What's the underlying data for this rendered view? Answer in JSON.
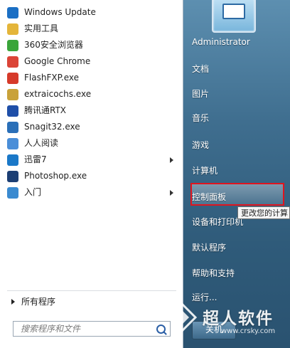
{
  "left_panel": {
    "items": [
      {
        "label": "Windows Update",
        "icon": "windows-update-icon",
        "color": "#1b6fc4",
        "submenu": false
      },
      {
        "label": "实用工具",
        "icon": "folder-icon",
        "color": "#e4b53a",
        "submenu": false
      },
      {
        "label": "360安全浏览器",
        "icon": "browser-360-icon",
        "color": "#3aa53a",
        "submenu": false
      },
      {
        "label": "Google Chrome",
        "icon": "chrome-icon",
        "color": "#db4437",
        "submenu": false
      },
      {
        "label": "FlashFXP.exe",
        "icon": "flashfxp-icon",
        "color": "#d63a2a",
        "submenu": false
      },
      {
        "label": "extraicochs.exe",
        "icon": "extraico-icon",
        "color": "#c9a23a",
        "submenu": false
      },
      {
        "label": "腾讯通RTX",
        "icon": "rtx-icon",
        "color": "#1f4fa8",
        "submenu": false
      },
      {
        "label": "Snagit32.exe",
        "icon": "snagit-icon",
        "color": "#2a6fb8",
        "submenu": false
      },
      {
        "label": "人人阅读",
        "icon": "reader-icon",
        "color": "#4a8ed8",
        "submenu": false
      },
      {
        "label": "迅雷7",
        "icon": "thunder-icon",
        "color": "#1a78c8",
        "submenu": true
      },
      {
        "label": "Photoshop.exe",
        "icon": "photoshop-icon",
        "color": "#1c3f74",
        "submenu": false
      },
      {
        "label": "入门",
        "icon": "getting-started-icon",
        "color": "#3a8ad0",
        "submenu": true
      }
    ],
    "all_programs": "所有程序",
    "search_placeholder": "搜索程序和文件"
  },
  "right_panel": {
    "items": [
      "Administrator",
      "文档",
      "图片",
      "音乐",
      "游戏",
      "计算机",
      "控制面板",
      "设备和打印机",
      "默认程序",
      "帮助和支持",
      "运行..."
    ],
    "highlighted": "控制面板",
    "tooltip": "更改您的计算",
    "shutdown_label": "关机"
  },
  "watermark": {
    "text": "超人软件",
    "url": "www.crsky.com"
  },
  "colors": {
    "highlight_border": "#e0141e",
    "panel_bg": "#3f6e8f"
  }
}
